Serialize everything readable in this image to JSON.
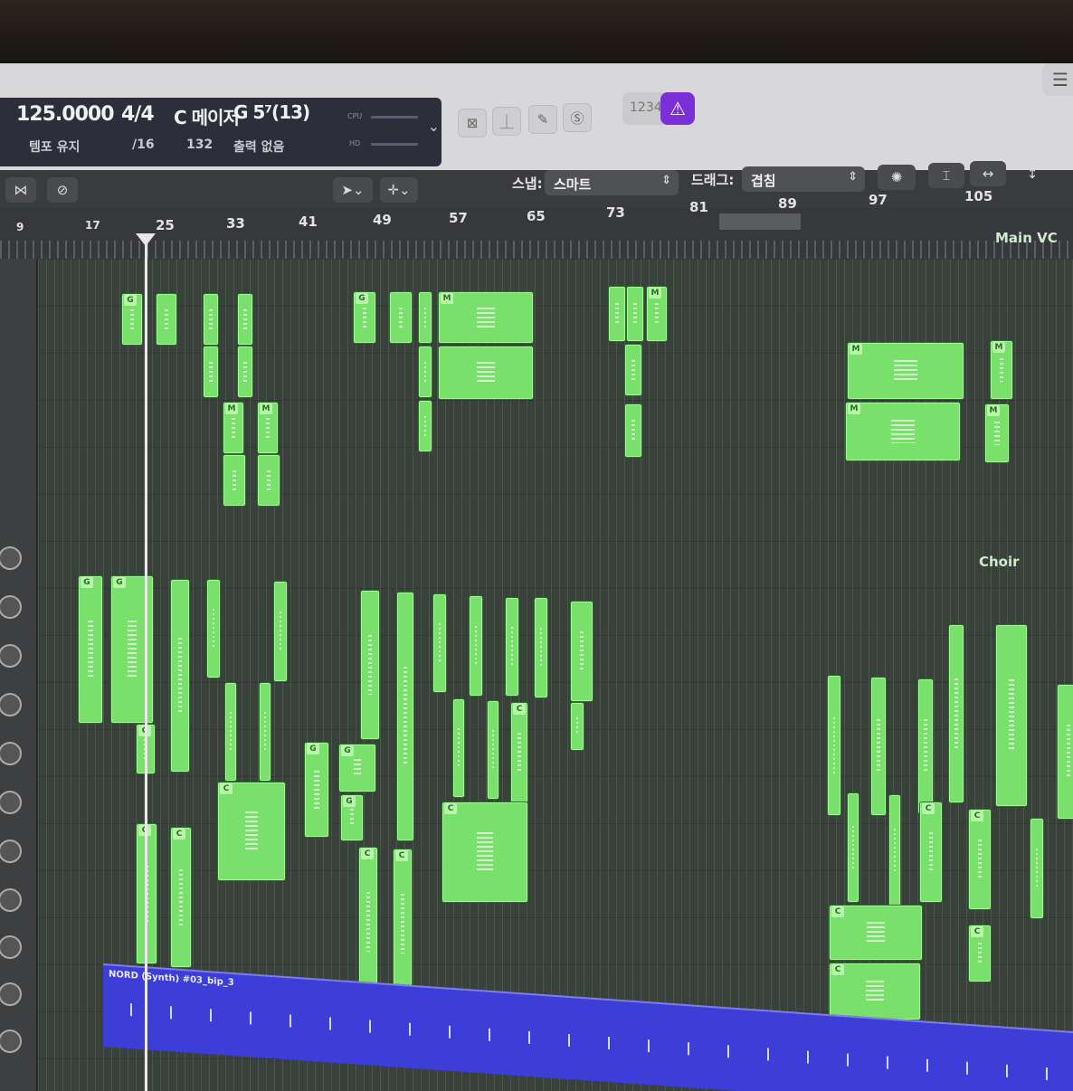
{
  "lcd": {
    "tempo": "125.0000",
    "tempo_label": "템포 유지",
    "signature": "4/4",
    "division": "/16",
    "key": "C 메이저",
    "key_value": "132",
    "chord": "G 5⁷(13)",
    "output": "출력 없음",
    "cpu": "CPU",
    "hd": "HD"
  },
  "toolbar": {
    "counter": "1234",
    "snap_label": "스냅:",
    "snap_value": "스마트",
    "drag_label": "드래그:",
    "drag_value": "겹침"
  },
  "ruler": {
    "bars": [
      "9",
      "17",
      "25",
      "33",
      "41",
      "49",
      "57",
      "65",
      "73",
      "81",
      "89",
      "97",
      "105"
    ]
  },
  "tracks": {
    "main_vc": "Main VC",
    "choir": "Choir"
  },
  "blue_region": {
    "label": "NORD (Synth) #03_bip_3"
  },
  "colors": {
    "region_green": "#79e06c",
    "region_blue": "#3d3ed8",
    "accent_purple": "#7b2fd6"
  }
}
